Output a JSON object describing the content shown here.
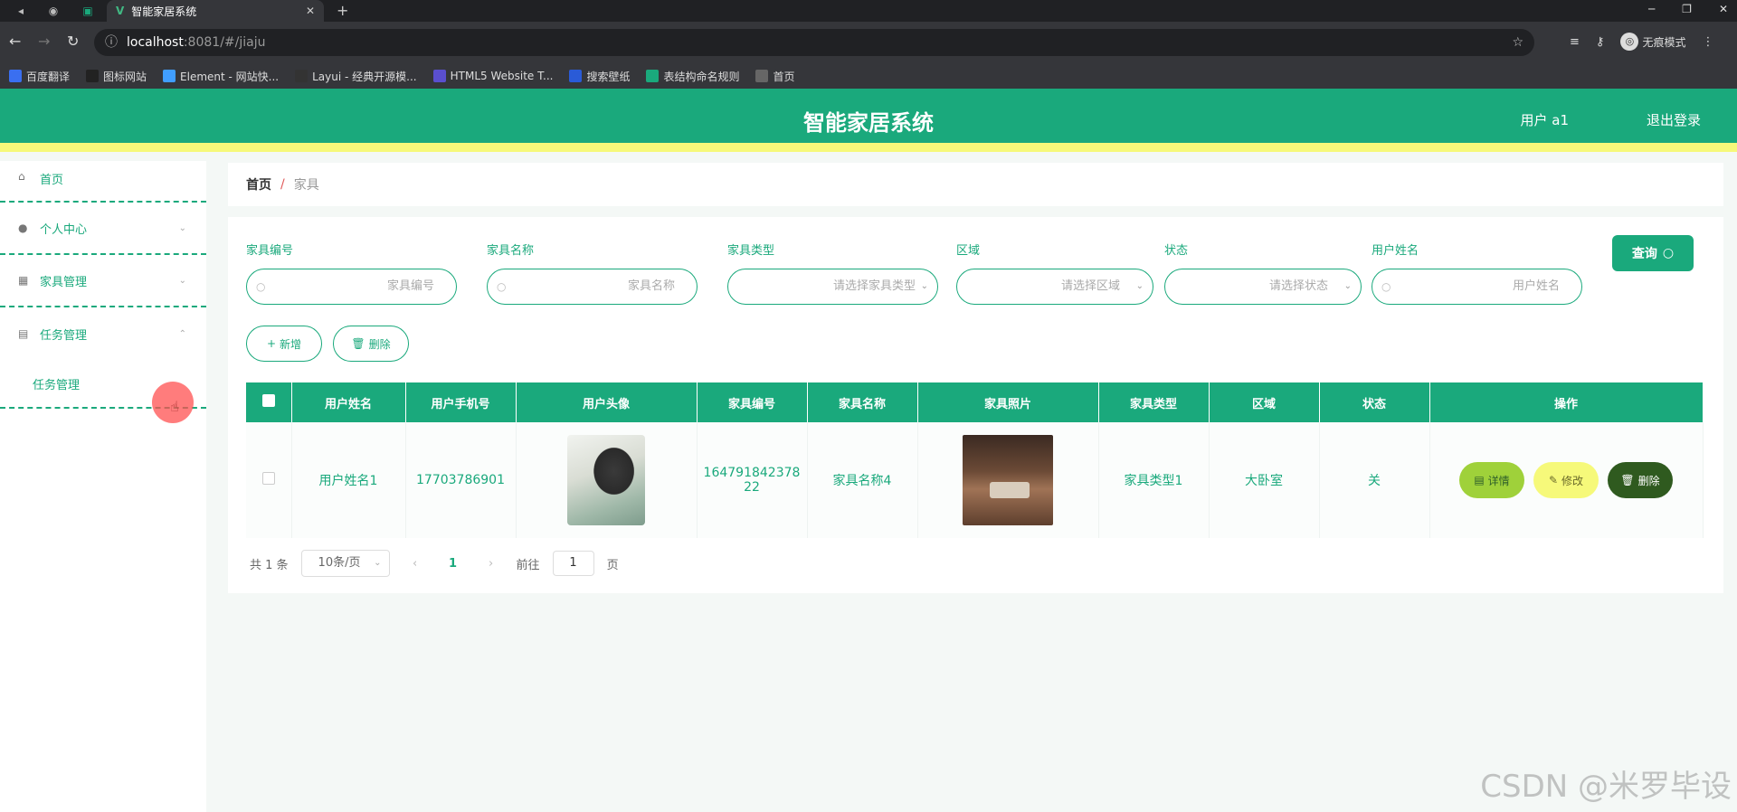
{
  "browser": {
    "tab_title": "智能家居系统",
    "url_host": "localhost",
    "url_rest": ":8081/#/jiaju",
    "incognito_label": "无痕模式",
    "bookmarks": [
      {
        "label": "百度翻译",
        "color": "#3a6ff0"
      },
      {
        "label": "图标网站",
        "color": "#222222"
      },
      {
        "label": "Element - 网站快...",
        "color": "#409eff"
      },
      {
        "label": "Layui - 经典开源模...",
        "color": "#333333"
      },
      {
        "label": "HTML5 Website T...",
        "color": "#5a4fcf"
      },
      {
        "label": "搜索壁纸",
        "color": "#2a5bd7"
      },
      {
        "label": "表结构命名规则",
        "color": "#1aa97c"
      },
      {
        "label": "首页",
        "color": "#666666"
      }
    ]
  },
  "header": {
    "title": "智能家居系统",
    "user": "用户 a1",
    "logout": "退出登录"
  },
  "sidebar": {
    "home": "首页",
    "items": [
      {
        "label": "个人中心"
      },
      {
        "label": "家具管理"
      },
      {
        "label": "任务管理"
      }
    ],
    "sub_item": "任务管理"
  },
  "breadcrumb": {
    "home": "首页",
    "sep": "/",
    "current": "家具"
  },
  "search": {
    "fields": [
      {
        "label": "家具编号",
        "placeholder": "家具编号"
      },
      {
        "label": "家具名称",
        "placeholder": "家具名称"
      },
      {
        "label": "家具类型",
        "placeholder": "请选择家具类型"
      },
      {
        "label": "区域",
        "placeholder": "请选择区域"
      },
      {
        "label": "状态",
        "placeholder": "请选择状态"
      },
      {
        "label": "用户姓名",
        "placeholder": "用户姓名"
      }
    ],
    "query_label": "查询"
  },
  "actions": {
    "add": "新增",
    "delete": "删除"
  },
  "table": {
    "headers": [
      "用户姓名",
      "用户手机号",
      "用户头像",
      "家具编号",
      "家具名称",
      "家具照片",
      "家具类型",
      "区域",
      "状态",
      "操作"
    ],
    "rows": [
      {
        "username": "用户姓名1",
        "phone": "17703786901",
        "furniture_no": "164791842378 22",
        "furniture_name": "家具名称4",
        "furniture_type": "家具类型1",
        "area": "大卧室",
        "status": "关",
        "btn_detail": "详情",
        "btn_edit": "修改",
        "btn_delete": "删除"
      }
    ]
  },
  "pagination": {
    "total": "共 1 条",
    "page_size": "10条/页",
    "current": "1",
    "goto_prefix": "前往",
    "goto_value": "1",
    "goto_suffix": "页"
  },
  "watermark": "CSDN @米罗毕设",
  "colors": {
    "primary": "#1aa97c",
    "accent_yellow": "#f6f97a",
    "detail_green": "#9fd13a",
    "delete_dark": "#2f5a1f"
  }
}
